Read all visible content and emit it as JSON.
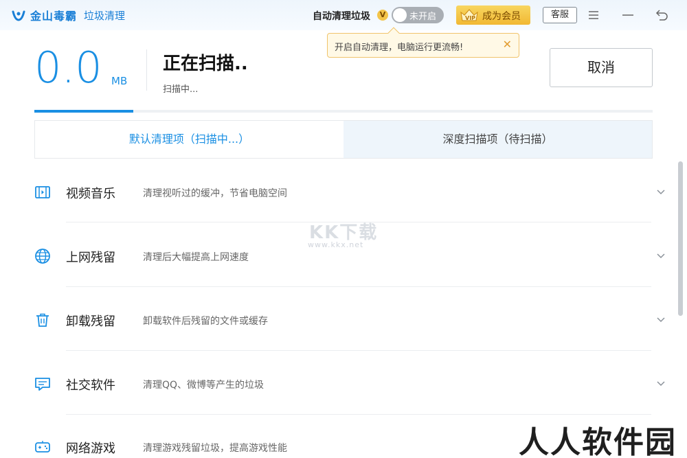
{
  "titlebar": {
    "brand": "金山毒霸",
    "module": "垃圾清理",
    "auto_clean_label": "自动清理垃圾",
    "v_badge": "V",
    "toggle_text": "未开启",
    "vip_label": "成为会员",
    "service_label": "客服"
  },
  "tooltip": {
    "text": "开启自动清理，电脑运行更流畅!",
    "close": "✕"
  },
  "scan": {
    "size_value": "0.0",
    "size_unit": "MB",
    "status_title": "正在扫描..",
    "status_sub": "扫描中...",
    "cancel_label": "取消",
    "progress": 0.16
  },
  "tabs": [
    {
      "label": "默认清理项（扫描中...）",
      "active": true
    },
    {
      "label": "深度扫描项（待扫描）",
      "active": false
    }
  ],
  "items": [
    {
      "icon": "video-music-icon",
      "title": "视频音乐",
      "desc": "清理视听过的缓冲，节省电脑空间"
    },
    {
      "icon": "globe-icon",
      "title": "上网残留",
      "desc": "清理后大幅提高上网速度"
    },
    {
      "icon": "trash-icon",
      "title": "卸载残留",
      "desc": "卸载软件后残留的文件或缓存"
    },
    {
      "icon": "chat-icon",
      "title": "社交软件",
      "desc": "清理QQ、微博等产生的垃圾"
    },
    {
      "icon": "gamepad-icon",
      "title": "网络游戏",
      "desc": "清理游戏残留垃圾，提高游戏性能"
    }
  ],
  "watermarks": {
    "kk": "KK下载",
    "kk_url": "www.kkx.net",
    "rr": "人人软件园"
  },
  "colors": {
    "accent": "#1a8fe3",
    "vip_gold": "#f1b833",
    "tooltip_border": "#f0c36a"
  }
}
